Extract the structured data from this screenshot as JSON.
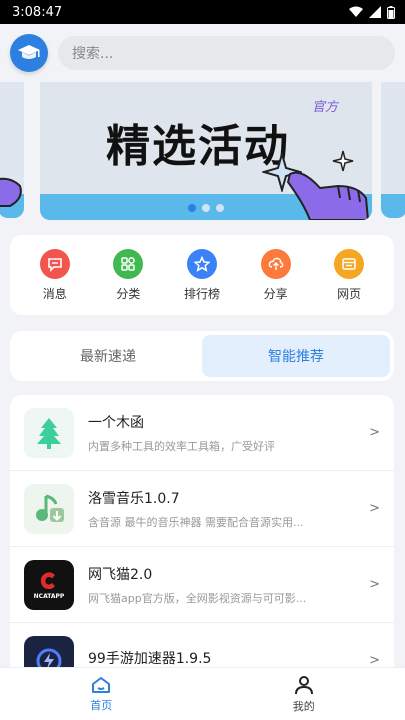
{
  "status": {
    "time": "3:08:47"
  },
  "search": {
    "placeholder": "搜索..."
  },
  "banner": {
    "title": "精选活动",
    "tag": "官方"
  },
  "quick_actions": [
    {
      "label": "消息",
      "icon": "message-icon",
      "color": "#f2554d"
    },
    {
      "label": "分类",
      "icon": "category-icon",
      "color": "#3fb950"
    },
    {
      "label": "排行榜",
      "icon": "star-icon",
      "color": "#3b82f6"
    },
    {
      "label": "分享",
      "icon": "upload-icon",
      "color": "#fb7a3c"
    },
    {
      "label": "网页",
      "icon": "web-icon",
      "color": "#f5a623"
    }
  ],
  "tabs": [
    {
      "label": "最新速递",
      "active": false
    },
    {
      "label": "智能推荐",
      "active": true
    }
  ],
  "apps": [
    {
      "name": "一个木函",
      "desc": "内置多种工具的效率工具箱，广受好评",
      "chevron": ">"
    },
    {
      "name": "洛雪音乐1.0.7",
      "desc": "含音源 最牛的音乐神器 需要配合音源实用...",
      "chevron": ">"
    },
    {
      "name": "网飞猫2.0",
      "desc": "网飞猫app官方版，全网影视资源与可可影...",
      "chevron": ">",
      "icon_text": "NCATAPP"
    },
    {
      "name": "99手游加速器1.9.5",
      "desc": "",
      "chevron": ">"
    }
  ],
  "bottom_nav": [
    {
      "label": "首页",
      "active": true
    },
    {
      "label": "我的",
      "active": false
    }
  ],
  "colors": {
    "accent": "#2d7fe0"
  }
}
